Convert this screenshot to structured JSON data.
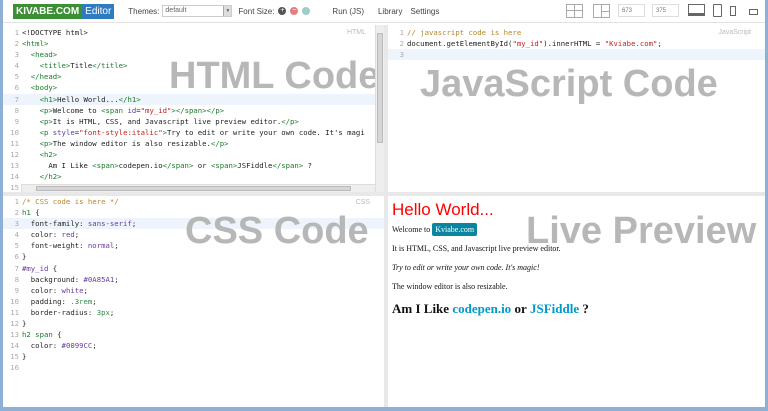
{
  "toolbar": {
    "brand": "KIVABE.COM",
    "brand_suffix": "Editor",
    "themes_label": "Themes:",
    "theme_value": "default",
    "font_size_label": "Font Size:",
    "run": "Run (JS)",
    "library": "Library",
    "settings": "Settings",
    "width": "673",
    "height": "375"
  },
  "html_pane": {
    "mode": "HTML",
    "watermark": "HTML Code",
    "lines": [
      [
        [
          "<!DOCTYPE html>",
          ""
        ]
      ],
      [
        [
          "<html>",
          "tag"
        ]
      ],
      [
        [
          "  <head>",
          "tag"
        ]
      ],
      [
        [
          "    <title>",
          "tag"
        ],
        [
          "Title",
          ""
        ],
        [
          "</title>",
          "tag"
        ]
      ],
      [
        [
          "  </head>",
          "tag"
        ]
      ],
      [
        [
          "  <body>",
          "tag"
        ]
      ],
      [
        [
          "    <h1>",
          "tag"
        ],
        [
          "Hello World...",
          ""
        ],
        [
          "</h1>",
          "tag"
        ]
      ],
      [
        [
          "    <p>",
          "tag"
        ],
        [
          "Welcome to ",
          ""
        ],
        [
          "<span ",
          "tag"
        ],
        [
          "id",
          "attr"
        ],
        [
          "=",
          ""
        ],
        [
          "\"my_id\"",
          "str"
        ],
        [
          "></span></p>",
          "tag"
        ]
      ],
      [
        [
          "    <p>",
          "tag"
        ],
        [
          "It is HTML, CSS, and Javascript live preview editor.",
          ""
        ],
        [
          "</p>",
          "tag"
        ]
      ],
      [
        [
          "    <p ",
          "tag"
        ],
        [
          "style",
          "attr"
        ],
        [
          "=",
          ""
        ],
        [
          "\"font-style:italic\"",
          "str"
        ],
        [
          ">",
          "tag"
        ],
        [
          "Try to edit or write your own code. It's magi",
          ""
        ]
      ],
      [
        [
          "    <p>",
          "tag"
        ],
        [
          "The window editor is also resizable.",
          ""
        ],
        [
          "</p>",
          "tag"
        ]
      ],
      [
        [
          "    <h2>",
          "tag"
        ]
      ],
      [
        [
          "      Am I Like ",
          ""
        ],
        [
          "<span>",
          "tag"
        ],
        [
          "codepen.io",
          ""
        ],
        [
          "</span>",
          "tag"
        ],
        [
          " or ",
          ""
        ],
        [
          "<span>",
          "tag"
        ],
        [
          "JSFiddle",
          ""
        ],
        [
          "</span>",
          "tag"
        ],
        [
          " ?",
          ""
        ]
      ],
      [
        [
          "    </h2>",
          "tag"
        ]
      ],
      [
        [
          "",
          ""
        ]
      ]
    ]
  },
  "js_pane": {
    "mode": "JavaScript",
    "watermark": "JavaScript Code",
    "lines": [
      [
        [
          "// javascript code is here",
          "com"
        ]
      ],
      [
        [
          "document.getElementById(",
          ""
        ],
        [
          "\"my_id\"",
          "str"
        ],
        [
          ").innerHTML = ",
          ""
        ],
        [
          "\"Kviabe.com\"",
          "str"
        ],
        [
          ";",
          ""
        ]
      ],
      [
        [
          "",
          ""
        ]
      ]
    ]
  },
  "css_pane": {
    "mode": "CSS",
    "watermark": "CSS Code",
    "lines": [
      [
        [
          "/* CSS code is here */",
          "com"
        ]
      ],
      [
        [
          "h1 ",
          "tag"
        ],
        [
          "{",
          ""
        ]
      ],
      [
        [
          "  font-family: ",
          ""
        ],
        [
          "sans-serif",
          "val"
        ],
        [
          ";",
          ""
        ]
      ],
      [
        [
          "  color: ",
          ""
        ],
        [
          "red",
          "val"
        ],
        [
          ";",
          ""
        ]
      ],
      [
        [
          "  font-weight: ",
          ""
        ],
        [
          "normal",
          "val"
        ],
        [
          ";",
          ""
        ]
      ],
      [
        [
          "}",
          ""
        ]
      ],
      [
        [
          "#my_id ",
          "val"
        ],
        [
          "{",
          ""
        ]
      ],
      [
        [
          "  background: ",
          ""
        ],
        [
          "#0A85A1",
          "val"
        ],
        [
          ";",
          ""
        ]
      ],
      [
        [
          "  color: ",
          ""
        ],
        [
          "white",
          "val"
        ],
        [
          ";",
          ""
        ]
      ],
      [
        [
          "  padding: ",
          ""
        ],
        [
          ".3rem",
          "num"
        ],
        [
          ";",
          ""
        ]
      ],
      [
        [
          "  border-radius: ",
          ""
        ],
        [
          "3px",
          "num"
        ],
        [
          ";",
          ""
        ]
      ],
      [
        [
          "}",
          ""
        ]
      ],
      [
        [
          "h2 span ",
          "tag"
        ],
        [
          "{",
          ""
        ]
      ],
      [
        [
          "  color: ",
          ""
        ],
        [
          "#0099CC",
          "val"
        ],
        [
          ";",
          ""
        ]
      ],
      [
        [
          "}",
          ""
        ]
      ],
      [
        [
          "",
          ""
        ]
      ]
    ]
  },
  "preview": {
    "watermark": "Live Preview",
    "h1": "Hello World...",
    "welcome": "Welcome to",
    "badge": "Kviabe.com",
    "p1": "It is HTML, CSS, and Javascript live preview editor.",
    "p2": "Try to edit or write your own code. It's magic!",
    "p3": "The window editor is also resizable.",
    "h2_a": "Am I Like",
    "h2_link1": "codepen.io",
    "h2_or": "or",
    "h2_link2": "JSFiddle",
    "h2_q": "?"
  }
}
